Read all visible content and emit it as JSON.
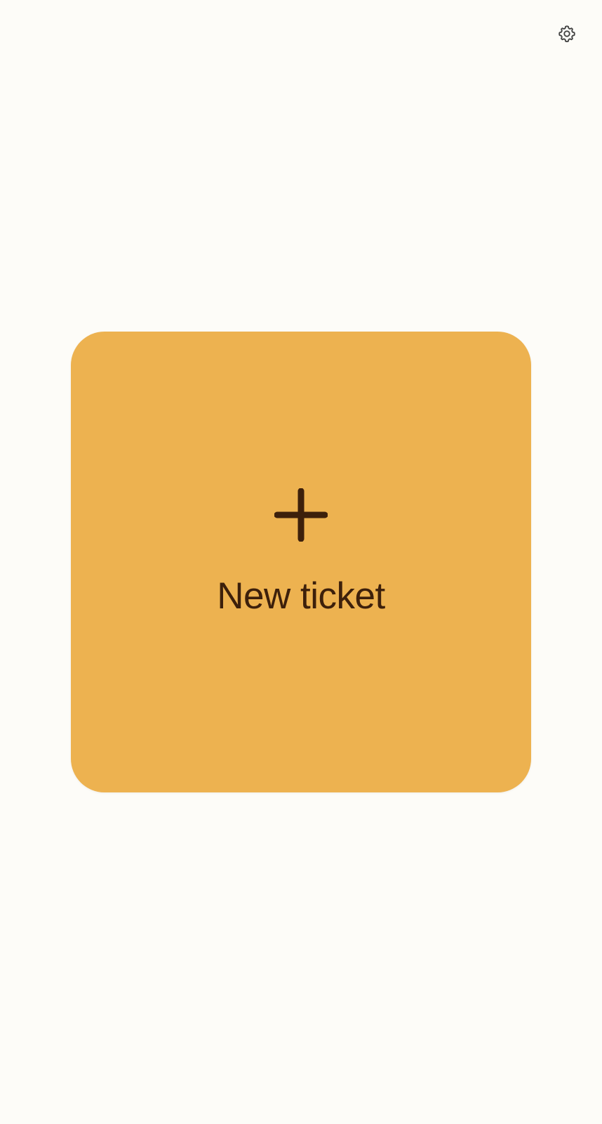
{
  "header": {
    "settings_icon": "gear-icon"
  },
  "main": {
    "new_ticket_label": "New ticket",
    "new_ticket_icon": "plus-icon"
  },
  "colors": {
    "page_background": "#fdfcf8",
    "card_background": "#edb250",
    "card_foreground": "#3d200b",
    "icon_color": "#444444"
  }
}
